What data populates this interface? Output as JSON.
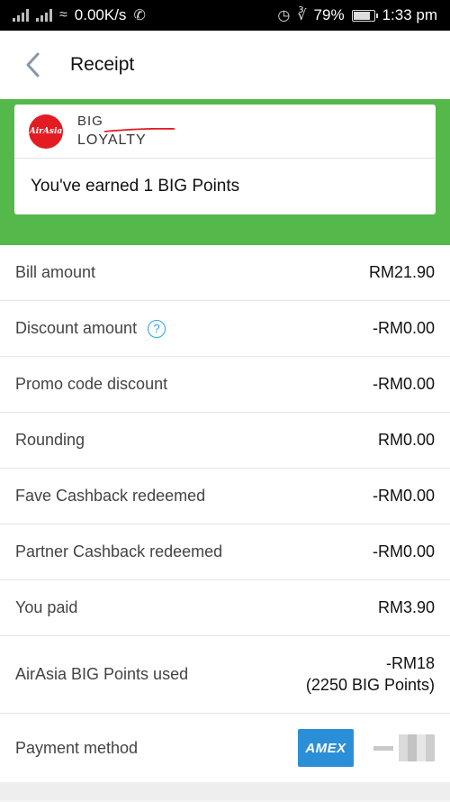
{
  "status_bar": {
    "network_speed": "0.00K/s",
    "battery_percent": "79%",
    "time": "1:33 pm",
    "icons": [
      "signal-icon",
      "wifi-icon",
      "whatsapp-icon",
      "alarm-icon",
      "bluetooth-icon",
      "battery-icon"
    ]
  },
  "header": {
    "title": "Receipt",
    "back_icon": "chevron-left-icon"
  },
  "loyalty": {
    "logo_text": "AirAsia",
    "brand_line1": "BIG",
    "brand_line2": "LOYALTY",
    "earned_text": "You've earned 1 BIG Points",
    "band_color": "#55b84a"
  },
  "receipt_rows": [
    {
      "label": "Bill amount",
      "value": "RM21.90"
    },
    {
      "label": "Discount amount",
      "value": "-RM0.00",
      "has_help_icon": true
    },
    {
      "label": "Promo code discount",
      "value": "-RM0.00"
    },
    {
      "label": "Rounding",
      "value": "RM0.00"
    },
    {
      "label": "Fave Cashback redeemed",
      "value": "-RM0.00"
    },
    {
      "label": "Partner Cashback redeemed",
      "value": "-RM0.00"
    },
    {
      "label": "You paid",
      "value": "RM3.90"
    }
  ],
  "big_points_row": {
    "label": "AirAsia BIG Points used",
    "value_line1": "-RM18",
    "value_line2": "(2250 BIG Points)"
  },
  "payment": {
    "label": "Payment method",
    "card_brand": "AMEX",
    "card_color": "#2a8fd6"
  }
}
